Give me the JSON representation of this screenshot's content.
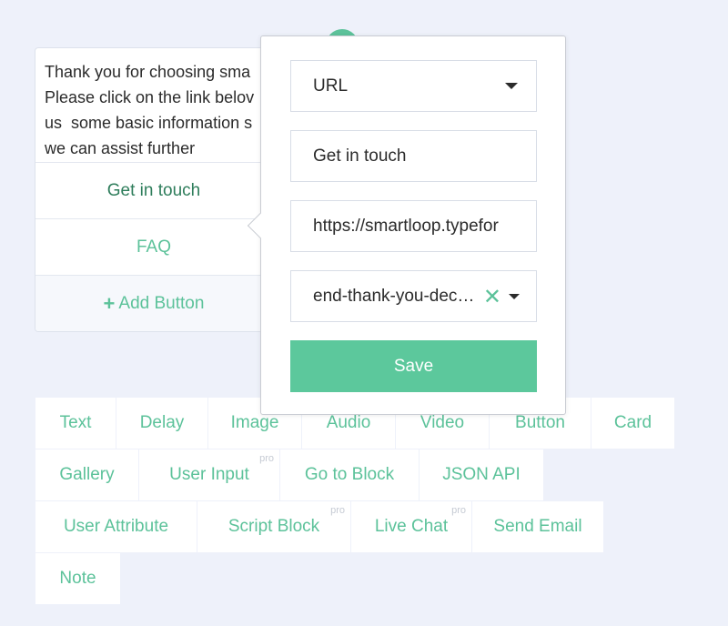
{
  "message": {
    "text": "Thank you for choosing sma\nPlease click on the link belov\nus  some basic information s\nwe can assist further",
    "buttons": [
      {
        "label": "Get in touch"
      },
      {
        "label": "FAQ"
      }
    ],
    "add_button_label": "Add Button"
  },
  "popup": {
    "type_select": "URL",
    "title_field": "Get in touch",
    "url_field": "https://smartloop.typefor",
    "block_select": "end-thank-you-dec…",
    "save_label": "Save"
  },
  "palette": {
    "row1": [
      "Text",
      "Delay",
      "Image",
      "Audio",
      "Video",
      "Button",
      "Card"
    ],
    "row2": [
      "Gallery",
      "User Input",
      "Go to Block",
      "JSON API"
    ],
    "row3": [
      "User Attribute",
      "Script Block",
      "Live Chat",
      "Send Email"
    ],
    "row4": [
      "Note"
    ],
    "pro_badge": "pro"
  },
  "colors": {
    "accent": "#5cc29a",
    "background": "#eef1fa"
  }
}
